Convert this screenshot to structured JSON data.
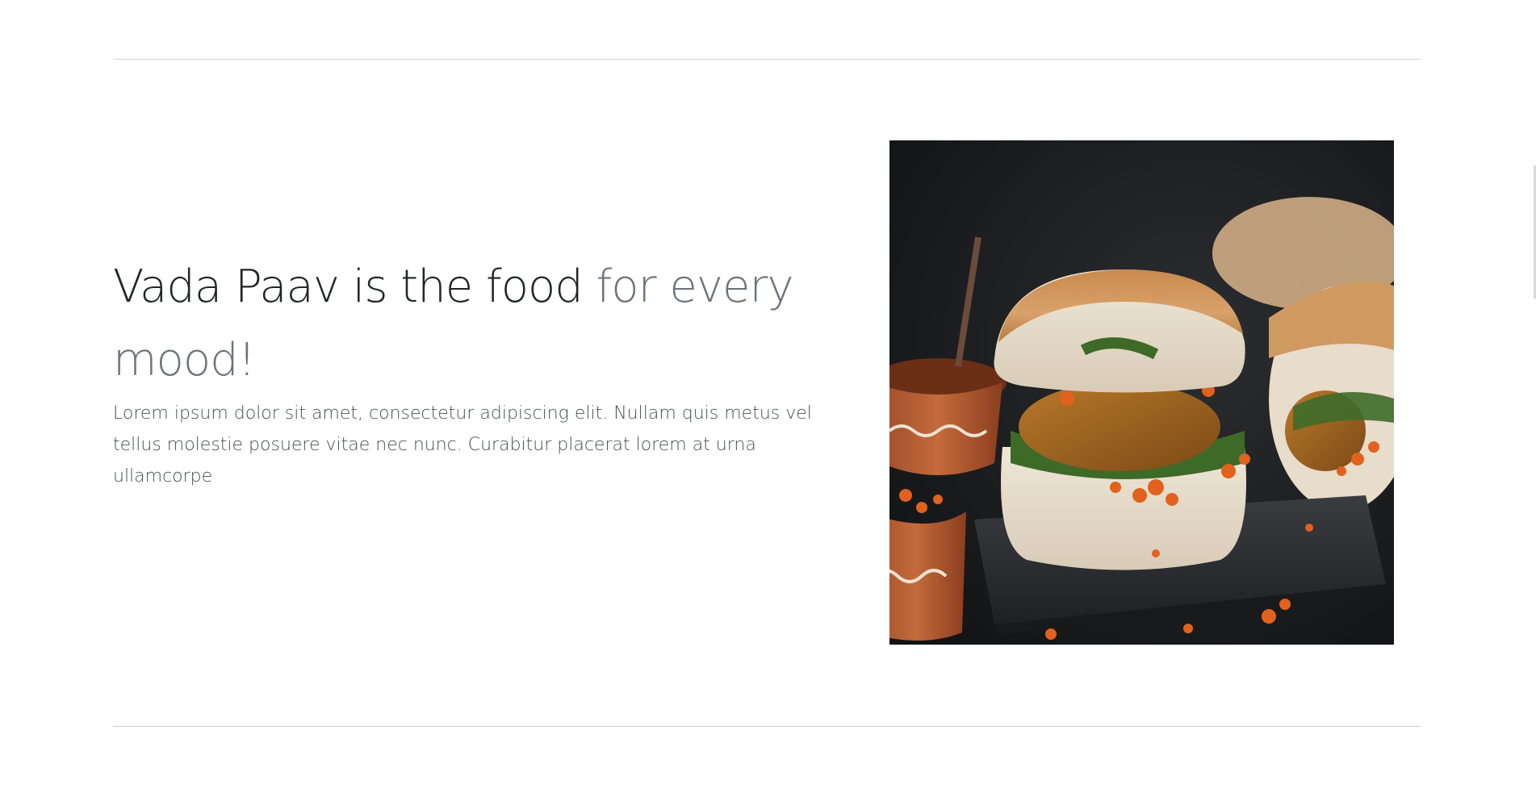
{
  "featurette": {
    "heading_main": "Vada Paav is the food ",
    "heading_muted": "for every mood!",
    "lead": "Lorem ipsum dolor sit amet, consectetur adipiscing elit. Nullam quis metus vel tellus molestie posuere vitae nec nunc. Curabitur placerat lorem at urna ullamcorpe",
    "image_alt": "vada-paav-photo"
  },
  "colors": {
    "heading": "#212529",
    "muted": "#6c757d",
    "lead": "#4a4f55",
    "divider": "#d4d6d8"
  }
}
